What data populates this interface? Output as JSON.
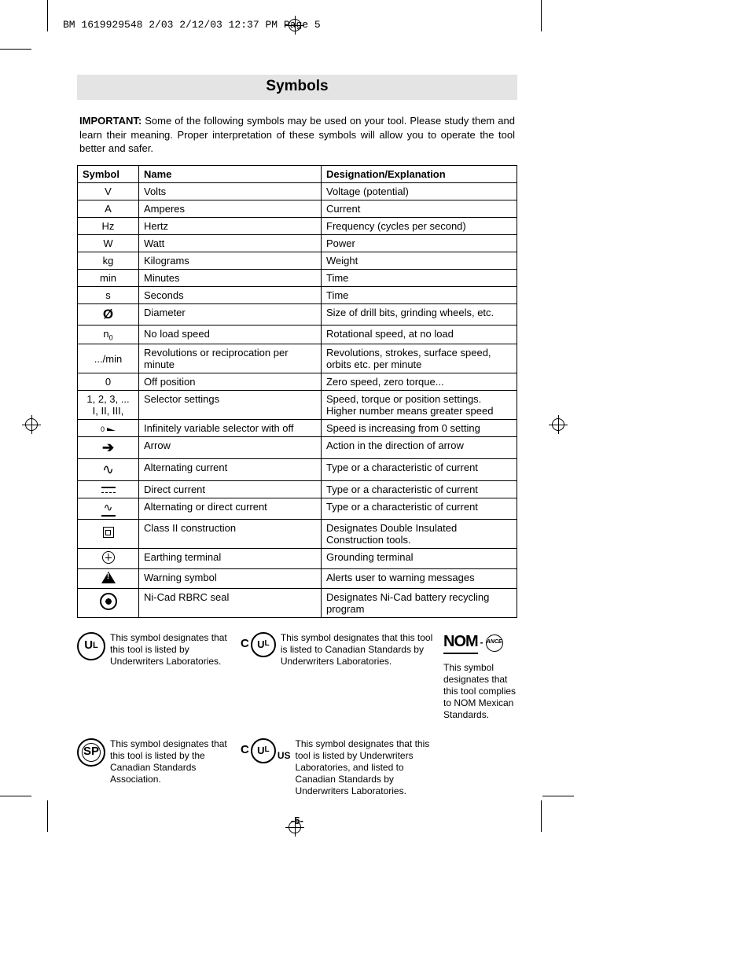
{
  "slug": "BM 1619929548 2/03  2/12/03  12:37 PM  Page 5",
  "title": "Symbols",
  "intro_bold": "IMPORTANT:",
  "intro_rest": " Some of the following symbols may be used on your tool.  Please study them and learn their meaning.  Proper interpretation of these symbols will allow you to operate the tool better and safer.",
  "headers": {
    "symbol": "Symbol",
    "name": "Name",
    "designation": "Designation/Explanation"
  },
  "rows": [
    {
      "sym": "V",
      "name": "Volts",
      "desig": "Voltage (potential)"
    },
    {
      "sym": "A",
      "name": "Amperes",
      "desig": "Current"
    },
    {
      "sym": "Hz",
      "name": "Hertz",
      "desig": "Frequency (cycles per second)"
    },
    {
      "sym": "W",
      "name": "Watt",
      "desig": "Power"
    },
    {
      "sym": "kg",
      "name": "Kilograms",
      "desig": "Weight"
    },
    {
      "sym": "min",
      "name": "Minutes",
      "desig": "Time"
    },
    {
      "sym": "s",
      "name": "Seconds",
      "desig": "Time"
    },
    {
      "sym": "dia",
      "name": "Diameter",
      "desig": "Size of drill bits, grinding wheels,  etc."
    },
    {
      "sym": "n0",
      "name": "No load speed",
      "desig": "Rotational speed, at no load"
    },
    {
      "sym": ".../min",
      "name": "Revolutions or reciprocation per minute",
      "desig": "Revolutions, strokes, surface speed, orbits etc. per minute"
    },
    {
      "sym": "0",
      "name": "Off position",
      "desig": "Zero speed, zero torque..."
    },
    {
      "sym": "1, 2, 3, ...\nI, II, III,",
      "name": "Selector settings",
      "desig": "Speed, torque or position settings. Higher number means greater speed"
    },
    {
      "sym": "sel",
      "name": "Infinitely variable selector with off",
      "desig": "Speed is increasing from 0 setting"
    },
    {
      "sym": "arrow",
      "name": "Arrow",
      "desig": "Action in the direction of arrow"
    },
    {
      "sym": "ac",
      "name": "Alternating current",
      "desig": "Type or a characteristic of current"
    },
    {
      "sym": "dc",
      "name": "Direct current",
      "desig": "Type or a characteristic of current"
    },
    {
      "sym": "acdc",
      "name": "Alternating or direct current",
      "desig": "Type or a characteristic of current"
    },
    {
      "sym": "class2",
      "name": "Class II  construction",
      "desig": "Designates Double Insulated Construction tools."
    },
    {
      "sym": "earth",
      "name": "Earthing terminal",
      "desig": "Grounding terminal"
    },
    {
      "sym": "warn",
      "name": "Warning symbol",
      "desig": "Alerts user to warning messages"
    },
    {
      "sym": "seal",
      "name": "Ni-Cad RBRC seal",
      "desig": "Designates Ni-Cad battery recycling program"
    }
  ],
  "certs": {
    "ul": "This symbol designates that this tool is listed by Underwriters Laboratories.",
    "cul": "This symbol designates that this tool is listed to Canadian Standards by Underwriters Laboratories.",
    "nom": "This symbol designates that this tool complies to NOM Mexican Standards.",
    "csa": "This symbol designates that this tool is listed by the Canadian Standards Association.",
    "culus": "This symbol designates that this tool is listed by Underwriters Laboratories, and listed to Canadian Standards by Underwriters Laboratories."
  },
  "pagenum": "-5-"
}
